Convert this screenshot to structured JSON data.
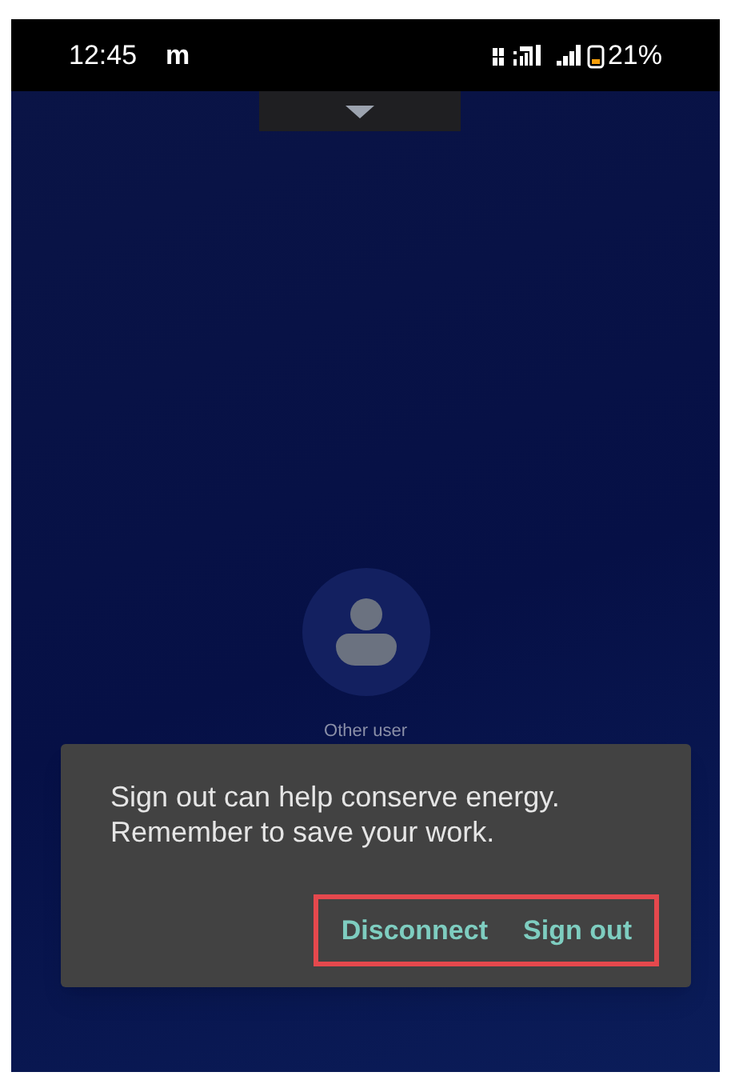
{
  "status_bar": {
    "time": "12:45",
    "notification": "m",
    "battery": "21%"
  },
  "user": {
    "name": "Other user"
  },
  "dialog": {
    "message": "Sign out can help conserve energy. Remember to save your work.",
    "buttons": [
      {
        "label": "Disconnect"
      },
      {
        "label": "Sign out"
      }
    ],
    "highlighted": true
  }
}
